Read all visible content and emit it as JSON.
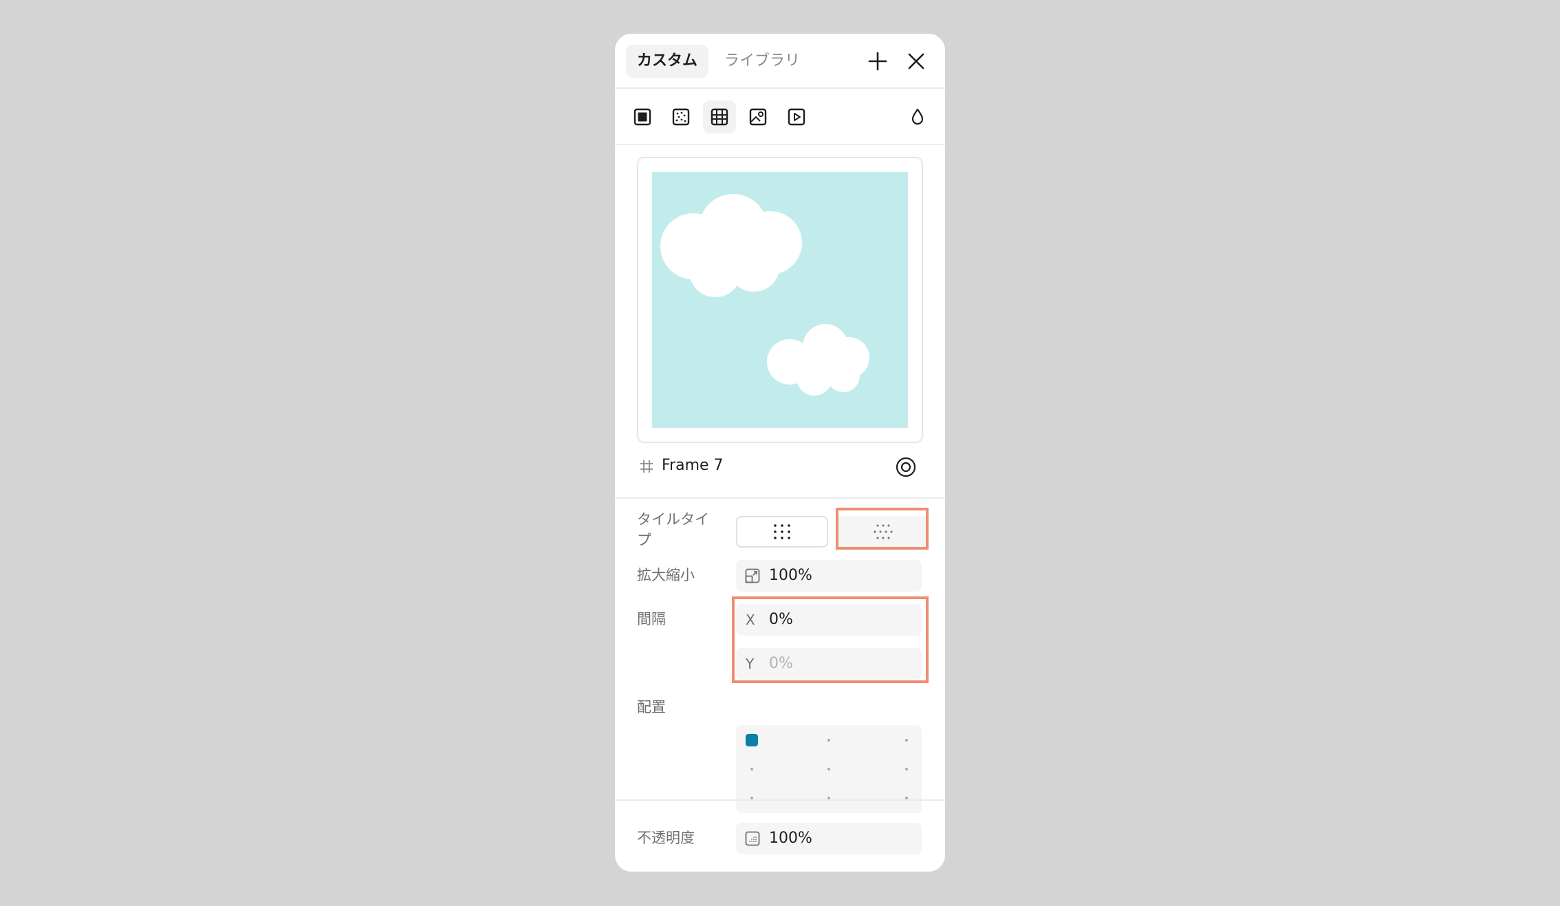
{
  "tabs": [
    {
      "label": "カスタム",
      "active": true
    },
    {
      "label": "ライブラリ",
      "active": false
    }
  ],
  "header_actions": {
    "add": "plus-icon",
    "close": "close-icon"
  },
  "toolbar": [
    {
      "icon": "solid-fill-icon",
      "selected": false
    },
    {
      "icon": "noise-fill-icon",
      "selected": false
    },
    {
      "icon": "pattern-fill-icon",
      "selected": true
    },
    {
      "icon": "image-fill-icon",
      "selected": false
    },
    {
      "icon": "video-fill-icon",
      "selected": false
    },
    {
      "icon": "blend-mode-drop-icon",
      "selected": false
    }
  ],
  "preview": {
    "background_color": "#c2ecec",
    "content": "clouds"
  },
  "source": {
    "name": "Frame 7",
    "icon": "frame-hash-icon",
    "action_icon": "target-icon"
  },
  "tile_type": {
    "label": "タイルタイプ",
    "options": [
      {
        "icon": "grid-tile-icon",
        "selected": false
      },
      {
        "icon": "offset-tile-icon",
        "selected": true
      }
    ]
  },
  "scale": {
    "label": "拡大縮小",
    "value": "100%",
    "icon": "scale-icon"
  },
  "spacing": {
    "label": "間隔",
    "x": {
      "prefix": "X",
      "value": "0%"
    },
    "y": {
      "prefix": "Y",
      "placeholder": "0%"
    }
  },
  "alignment": {
    "label": "配置",
    "selected": "top-left"
  },
  "opacity": {
    "label": "不透明度",
    "value": "100%",
    "icon": "opacity-icon"
  },
  "colors": {
    "accent": "#0e7fa8",
    "highlight": "#ef8d72",
    "sky": "#c2ecec"
  }
}
